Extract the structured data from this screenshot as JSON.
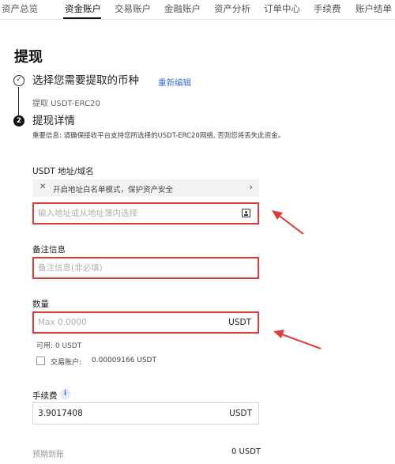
{
  "nav": {
    "tabs": [
      {
        "label": "资产总览"
      },
      {
        "label": "资金账户"
      },
      {
        "label": "交易账户"
      },
      {
        "label": "金融账户"
      },
      {
        "label": "资产分析"
      },
      {
        "label": "订单中心"
      },
      {
        "label": "手续费"
      },
      {
        "label": "账户结单"
      }
    ],
    "active_index": 1
  },
  "page": {
    "title": "提现"
  },
  "step1": {
    "number": "✓",
    "title": "选择您需要提取的币种",
    "reedit": "重新编辑",
    "subtitle": "提取 USDT-ERC20"
  },
  "step2": {
    "number": "2",
    "title": "提现详情",
    "notice": "重要信息: 请确保接收平台支持您所选择的USDT-ERC20网络, 否则您将丢失此资金。"
  },
  "address": {
    "label": "USDT 地址/域名",
    "whitelist_text": "开启地址白名单模式，保护资产安全",
    "whitelist_close": "✕",
    "whitelist_chevron": "›",
    "placeholder": "输入地址或从地址簿内选择"
  },
  "memo": {
    "label": "备注信息",
    "placeholder": "备注信息(非必填)"
  },
  "amount": {
    "label": "数量",
    "placeholder": "Max 0.0000",
    "unit": "USDT",
    "available": "可用: 0 USDT",
    "trading_label": "交易账户:",
    "trading_amount": "0.00009166 USDT"
  },
  "fee": {
    "label": "手续费",
    "info": "i",
    "value": "3.9017408",
    "unit": "USDT"
  },
  "arrival": {
    "label": "预期到账",
    "value": "0 USDT"
  },
  "colors": {
    "highlight_red": "#e23a3a",
    "link_blue": "#3d6fd6"
  }
}
